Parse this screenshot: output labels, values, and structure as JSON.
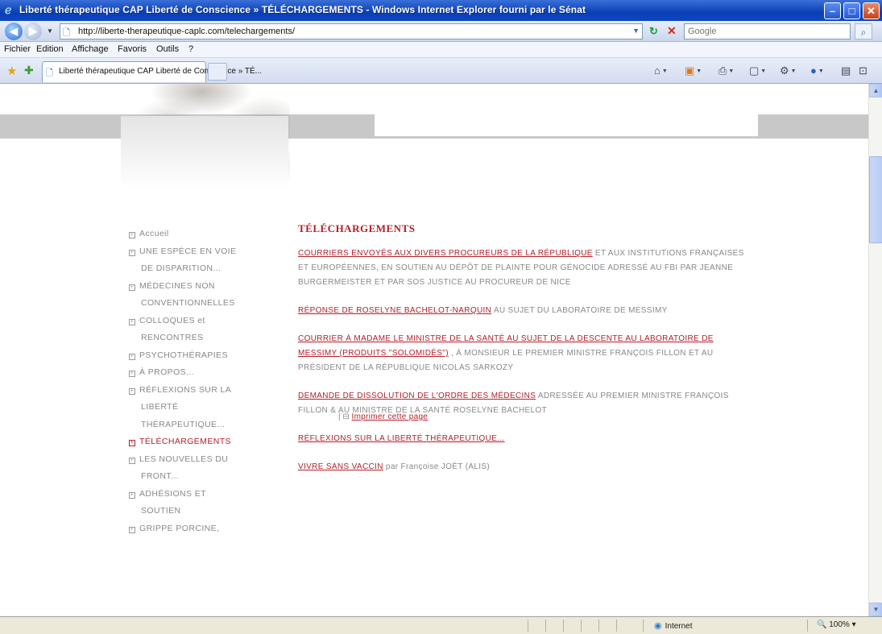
{
  "window": {
    "title": "Liberté thérapeutique CAP Liberté de Conscience » TÉLÉCHARGEMENTS - Windows Internet Explorer fourni par le Sénat"
  },
  "address_bar": {
    "url": "http://liberte-therapeutique-caplc.com/telechargements/",
    "search_placeholder": "Google"
  },
  "menu": {
    "items": [
      "Fichier",
      "Edition",
      "Affichage",
      "Favoris",
      "Outils",
      "?"
    ]
  },
  "tab": {
    "label": "Liberté thérapeutique CAP Liberté de Conscience » TÉ..."
  },
  "sidebar": {
    "items": [
      {
        "lines": [
          "Accueil"
        ],
        "active": false
      },
      {
        "lines": [
          "UNE ESPÈCE EN VOIE",
          "DE DISPARITION..."
        ],
        "active": false
      },
      {
        "lines": [
          "MÉDECINES NON",
          "CONVENTIONNELLES"
        ],
        "active": false
      },
      {
        "lines": [
          "COLLOQUES et",
          "RENCONTRES"
        ],
        "active": false
      },
      {
        "lines": [
          "PSYCHOTHÉRAPIES"
        ],
        "active": false
      },
      {
        "lines": [
          "À PROPOS..."
        ],
        "active": false
      },
      {
        "lines": [
          "RÉFLEXIONS SUR LA",
          "LIBERTÉ",
          "THÉRAPEUTIQUE..."
        ],
        "active": false
      },
      {
        "lines": [
          "TÉLÉCHARGEMENTS"
        ],
        "active": true
      },
      {
        "lines": [
          "LES NOUVELLES DU",
          "FRONT..."
        ],
        "active": false
      },
      {
        "lines": [
          "ADHÉSIONS ET",
          "SOUTIEN"
        ],
        "active": false
      },
      {
        "lines": [
          "GRIPPE PORCINE,"
        ],
        "active": false
      }
    ]
  },
  "main": {
    "title": "TÉLÉCHARGEMENTS",
    "entries": [
      {
        "link": "COURRIERS ENVOYÉS AUX DIVERS PROCUREURS DE LA RÉPUBLIQUE",
        "text": " ET AUX INSTITUTIONS FRANÇAISES ET EUROPÉENNES, EN SOUTIEN AU DÉPÔT DE PLAINTE POUR GÉNOCIDE ADRESSÉ AU FBI PAR JEANNE BURGERMEISTER ET PAR SOS JUSTICE AU PROCUREUR DE NICE"
      },
      {
        "link": "RÉPONSE DE ROSELYNE BACHELOT-NARQUIN",
        "text": " AU SUJET DU LABORATOIRE DE MESSIMY"
      },
      {
        "link": "COURRIER À MADAME LE MINISTRE DE LA SANTÉ AU SUJET DE LA DESCENTE AU LABORATOIRE DE MESSIMY (PRODUITS \"SOLOMIDÈS\")",
        "text": " , À MONSIEUR LE PREMIER MINISTRE FRANÇOIS FILLON ET AU PRÉSIDENT DE LA RÉPUBLIQUE NICOLAS SARKOZY"
      },
      {
        "link": "DEMANDE DE DISSOLUTION DE L'ORDRE DES MÉDECINS",
        "text": " ADRESSÉE AU PREMIER MINISTRE FRANÇOIS FILLON & AU MINISTRE DE LA SANTÉ ROSELYNE BACHELOT"
      },
      {
        "link": "RÉFLEXIONS SUR LA LIBERTÉ THÉRAPEUTIQUE...",
        "text": ""
      },
      {
        "link": "VIVRE SANS VACCIN",
        "text": " par Françoise JOËT (ALIS)"
      }
    ],
    "print_link": "Imprimer cette page"
  },
  "statusbar": {
    "zone": "Internet",
    "zoom": "100%"
  },
  "icons": [
    "ie-logo-icon",
    "back-icon",
    "forward-icon",
    "page-icon",
    "refresh-icon",
    "stop-icon",
    "search-icon",
    "favorites-star-icon",
    "add-favorite-icon",
    "home-icon",
    "feeds-icon",
    "print-icon",
    "page-menu-icon",
    "tools-icon",
    "help-icon",
    "globe-icon"
  ],
  "colors": {
    "accent": "#b3202a",
    "titlebar": "#0a3fb4"
  }
}
